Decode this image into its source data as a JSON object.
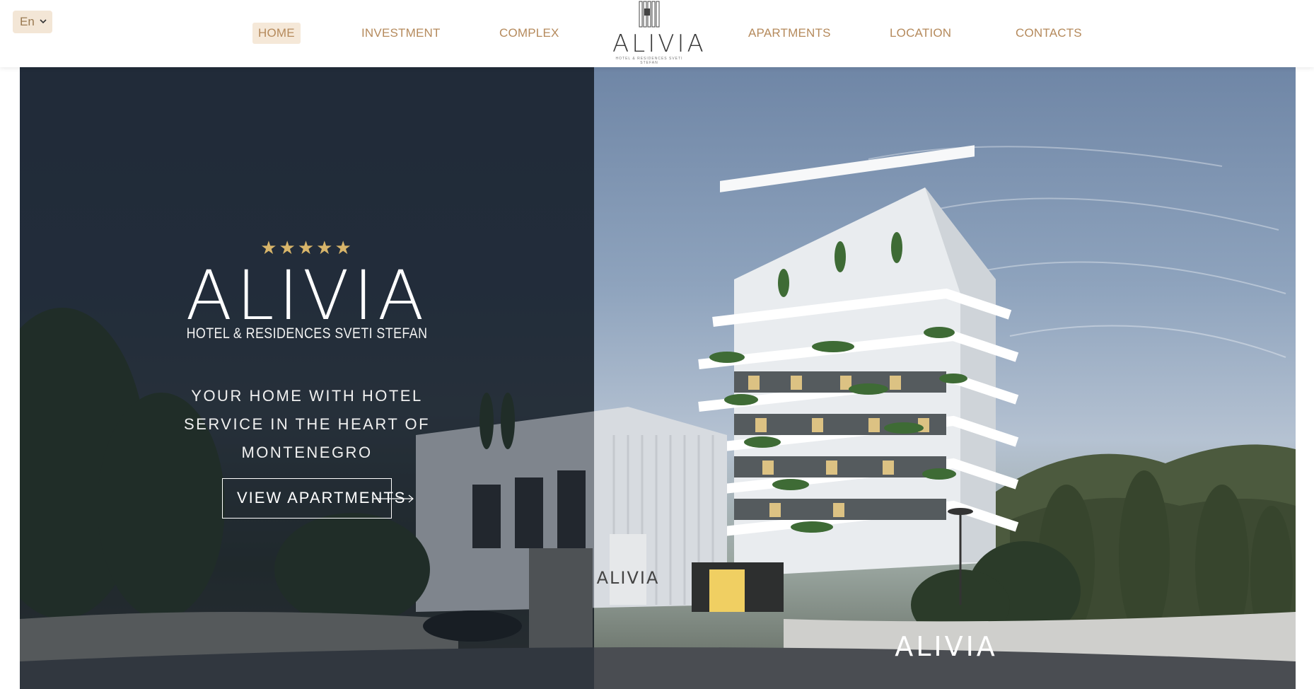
{
  "language_select": {
    "value": "En"
  },
  "nav": {
    "home": "HOME",
    "investment": "INVESTMENT",
    "complex": "COMPLEX",
    "apartments": "APARTMENTS",
    "location": "LOCATION",
    "contacts": "CONTACTS"
  },
  "logo": {
    "word": "ALIVIA",
    "sub": "HOTEL & RESIDENCES SVETI STEFAN"
  },
  "hero": {
    "stars": "★★★★★",
    "rating": 5,
    "title": "ALIVIA",
    "subtitle": "HOTEL & RESIDENCES SVETI STEFAN",
    "tagline": "YOUR HOME WITH HOTEL SERVICE IN THE HEART OF MONTENEGRO",
    "cta_label": "VIEW APARTMENTS",
    "building_sign": "ALIVIA",
    "wall_sign": "ALIVIA"
  },
  "colors": {
    "accent": "#b58a5c",
    "active_bg": "#f5e8d8",
    "star": "#d8b56a"
  }
}
